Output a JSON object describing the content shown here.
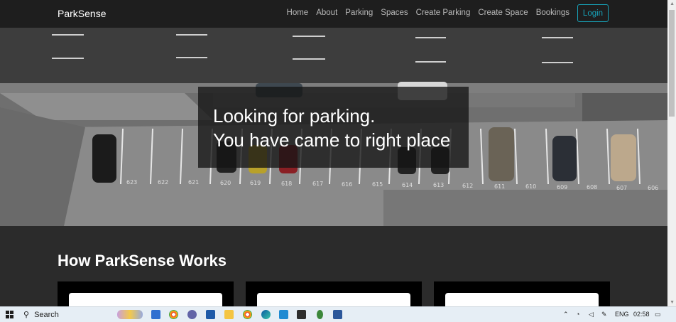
{
  "navbar": {
    "brand": "ParkSense",
    "links": [
      "Home",
      "About",
      "Parking",
      "Spaces",
      "Create Parking",
      "Create Space",
      "Bookings"
    ],
    "login_label": "Login",
    "accent_color": "#17a2b8"
  },
  "hero": {
    "line1": "Looking for parking.",
    "line2": "You have came to right place",
    "stall_numbers": [
      "623",
      "622",
      "621",
      "620",
      "619",
      "618",
      "617",
      "616",
      "615",
      "614",
      "613",
      "612",
      "611",
      "610",
      "609",
      "608",
      "607",
      "606"
    ]
  },
  "section": {
    "title": "How ParkSense Works"
  },
  "taskbar": {
    "search_label": "Search",
    "language": "ENG",
    "time": "02:58",
    "icons": [
      "start-icon",
      "search-icon",
      "widgets-icon",
      "mail-icon",
      "chrome-icon",
      "chat-icon",
      "store-icon",
      "file-explorer-icon",
      "chrome-icon",
      "edge-icon",
      "vscode-icon",
      "terminal-icon",
      "node-icon",
      "word-icon"
    ]
  }
}
